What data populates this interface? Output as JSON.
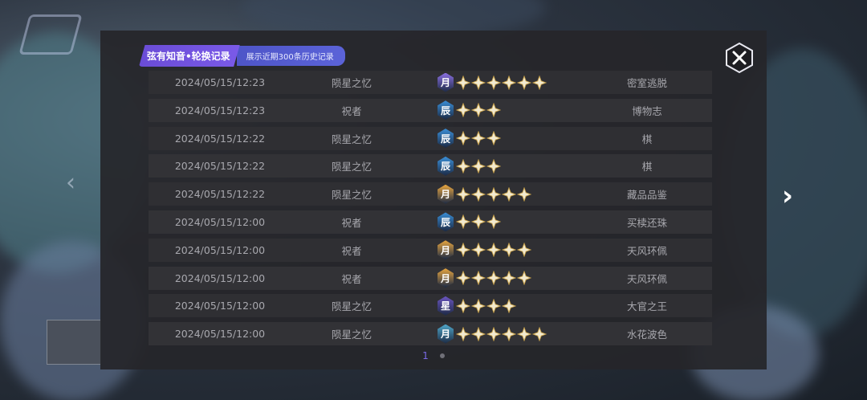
{
  "header": {
    "title": "弦有知音•轮换记录",
    "subtitle": "展示近期300条历史记录"
  },
  "colors": {
    "gold": "#e8a640",
    "blue": "#3a8fd8",
    "purple": "#7a5fd0",
    "accent": "#6a4cd6"
  },
  "records": [
    {
      "time": "2024/05/15/12:23",
      "type": "陨星之忆",
      "rank": "月",
      "rank_color": "#8a6fe0",
      "stars": 6,
      "name": "密室逃脱"
    },
    {
      "time": "2024/05/15/12:23",
      "type": "祝者",
      "rank": "辰",
      "rank_color": "#3a8fd8",
      "stars": 3,
      "name": "博物志"
    },
    {
      "time": "2024/05/15/12:22",
      "type": "陨星之忆",
      "rank": "辰",
      "rank_color": "#3a8fd8",
      "stars": 3,
      "name": "棋"
    },
    {
      "time": "2024/05/15/12:22",
      "type": "陨星之忆",
      "rank": "辰",
      "rank_color": "#3a8fd8",
      "stars": 3,
      "name": "棋"
    },
    {
      "time": "2024/05/15/12:22",
      "type": "陨星之忆",
      "rank": "月",
      "rank_color": "#e8a640",
      "stars": 5,
      "name": "藏品品鉴"
    },
    {
      "time": "2024/05/15/12:00",
      "type": "祝者",
      "rank": "辰",
      "rank_color": "#3a8fd8",
      "stars": 3,
      "name": "买椟还珠"
    },
    {
      "time": "2024/05/15/12:00",
      "type": "祝者",
      "rank": "月",
      "rank_color": "#e8a640",
      "stars": 5,
      "name": "天风环佩"
    },
    {
      "time": "2024/05/15/12:00",
      "type": "祝者",
      "rank": "月",
      "rank_color": "#e8a640",
      "stars": 5,
      "name": "天风环佩"
    },
    {
      "time": "2024/05/15/12:00",
      "type": "陨星之忆",
      "rank": "星",
      "rank_color": "#6a55c0",
      "stars": 4,
      "name": "大官之王"
    },
    {
      "time": "2024/05/15/12:00",
      "type": "陨星之忆",
      "rank": "月",
      "rank_color": "#4fa6c8",
      "stars": 6,
      "name": "水花波色"
    }
  ],
  "pagination": {
    "current": "1"
  },
  "icons": {
    "close": "close-x-icon",
    "next": "chevron-right-icon",
    "prev": "chevron-left-icon",
    "star": "star-icon"
  }
}
